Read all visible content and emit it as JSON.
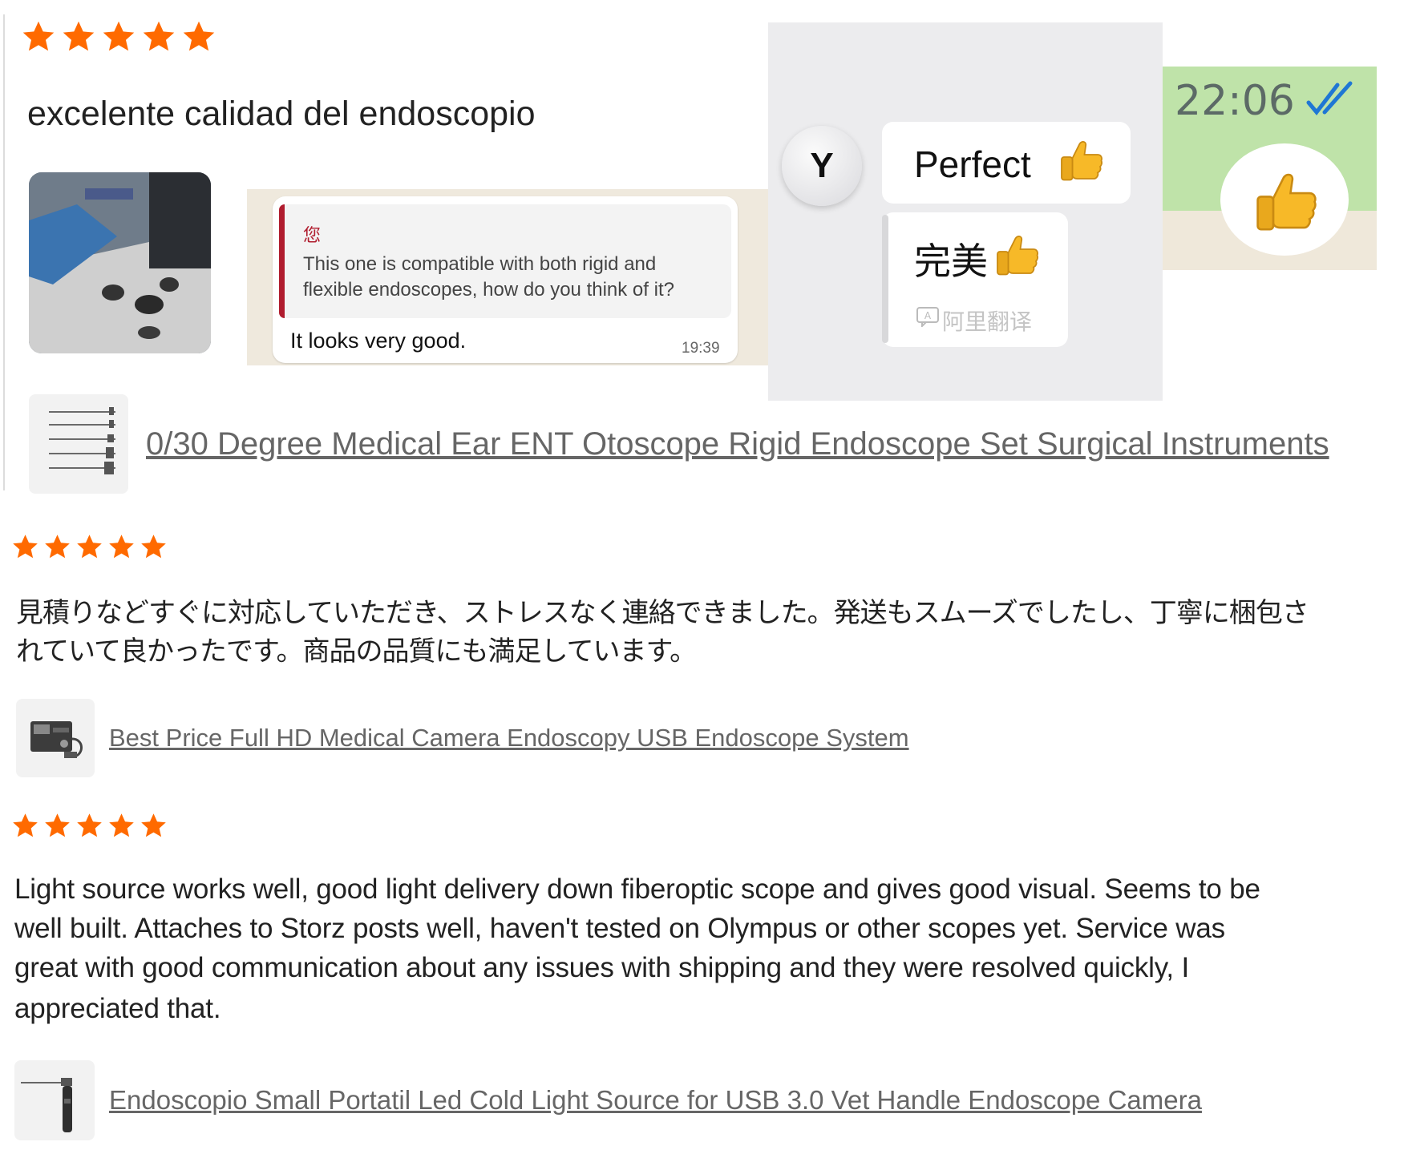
{
  "colors": {
    "star": "#ff6a00",
    "link": "#666666",
    "quote_bar": "#b01c2e",
    "whatsapp_green": "#bfe3a9",
    "check_blue": "#1f77d4"
  },
  "reviews": [
    {
      "rating": 5,
      "text": "excelente calidad del endoscopio",
      "chat": {
        "quote_sender": "您",
        "quote_text_1": "This one is compatible with both rigid and",
        "quote_text_2": "flexible endoscopes, how do you think of it?",
        "reply": "It looks very good.",
        "time": "19:39"
      },
      "translate": {
        "avatar_letter": "Y",
        "message": "Perfect",
        "translation": "完美",
        "service": "阿里翻译"
      },
      "whatsapp": {
        "time": "22:06"
      },
      "product": {
        "title": "0/30 Degree Medical Ear ENT Otoscope Rigid Endoscope Set Surgical Instruments",
        "icon": "endoscope-set-icon"
      }
    },
    {
      "rating": 5,
      "text_line1": "見積りなどすぐに対応していただき、ストレスなく連絡できました。発送もスムーズでしたし、丁寧に梱包さ",
      "text_line2": "れていて良かったです。商品の品質にも満足しています。",
      "product": {
        "title": "Best Price Full HD Medical Camera Endoscopy USB Endoscope System",
        "icon": "camera-system-icon"
      }
    },
    {
      "rating": 5,
      "text_line1": "Light source works well, good light delivery down fiberoptic scope and gives good visual. Seems to be",
      "text_line2": "well built. Attaches to Storz posts well, haven't tested on Olympus or other scopes yet. Service was",
      "text_line3": "great with good communication about any issues with shipping and they were resolved quickly, I",
      "text_line4": "appreciated that.",
      "product": {
        "title": "Endoscopio Small Portatil Led Cold Light Source for USB 3.0 Vet Handle Endoscope Camera",
        "icon": "light-source-icon"
      }
    }
  ]
}
